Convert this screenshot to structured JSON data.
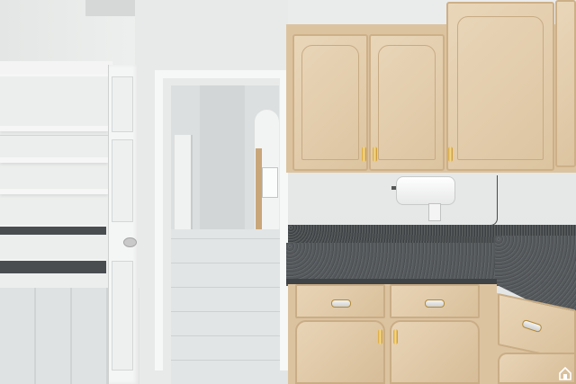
{
  "scene": {
    "description_alt": "",
    "colors": {
      "cabinet": "#e3ceae",
      "granite": "#55595c",
      "wall": "#e8eaea",
      "tile": "#dfe2e2",
      "hardware": "#d9a53a"
    }
  },
  "icons": {
    "watermark": "house-logo-icon"
  }
}
